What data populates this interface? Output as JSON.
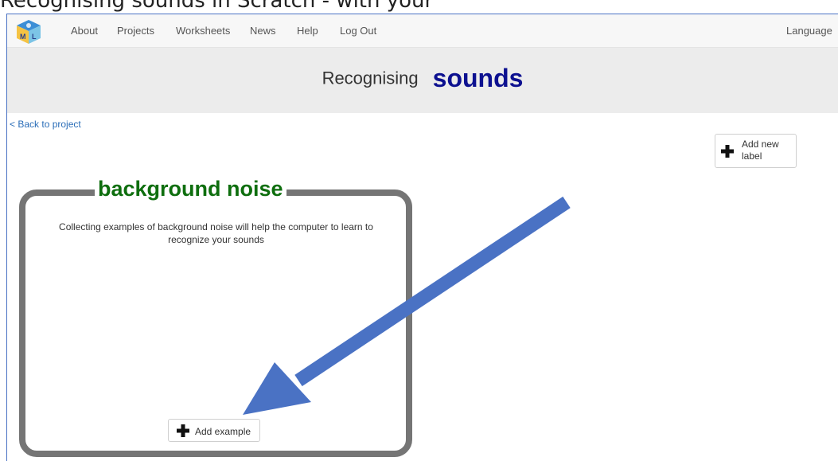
{
  "crop_top_text": "Recognising sounds in Scratch - with your",
  "navbar": {
    "items": [
      "About",
      "Projects",
      "Worksheets",
      "News",
      "Help",
      "Log Out"
    ],
    "language": "Language",
    "logo_text": "ML"
  },
  "header": {
    "title_prefix": "Recognising",
    "title_type": "sounds"
  },
  "back_link": "< Back to project",
  "add_label_button": {
    "label": "Add new label",
    "icon": "plus-icon"
  },
  "label_bucket": {
    "name": "background noise",
    "description": "Collecting examples of background noise will help the computer to learn to recognize your sounds",
    "add_example_label": "Add example",
    "icon": "plus-icon"
  },
  "annotation": {
    "arrow_color": "#4a72c4",
    "target": "add-example-button"
  },
  "colors": {
    "title_type": "#0d1190",
    "label_name": "#0e6e0e",
    "label_border": "#757575",
    "link": "#2a6db8",
    "header_band": "#ececec"
  }
}
